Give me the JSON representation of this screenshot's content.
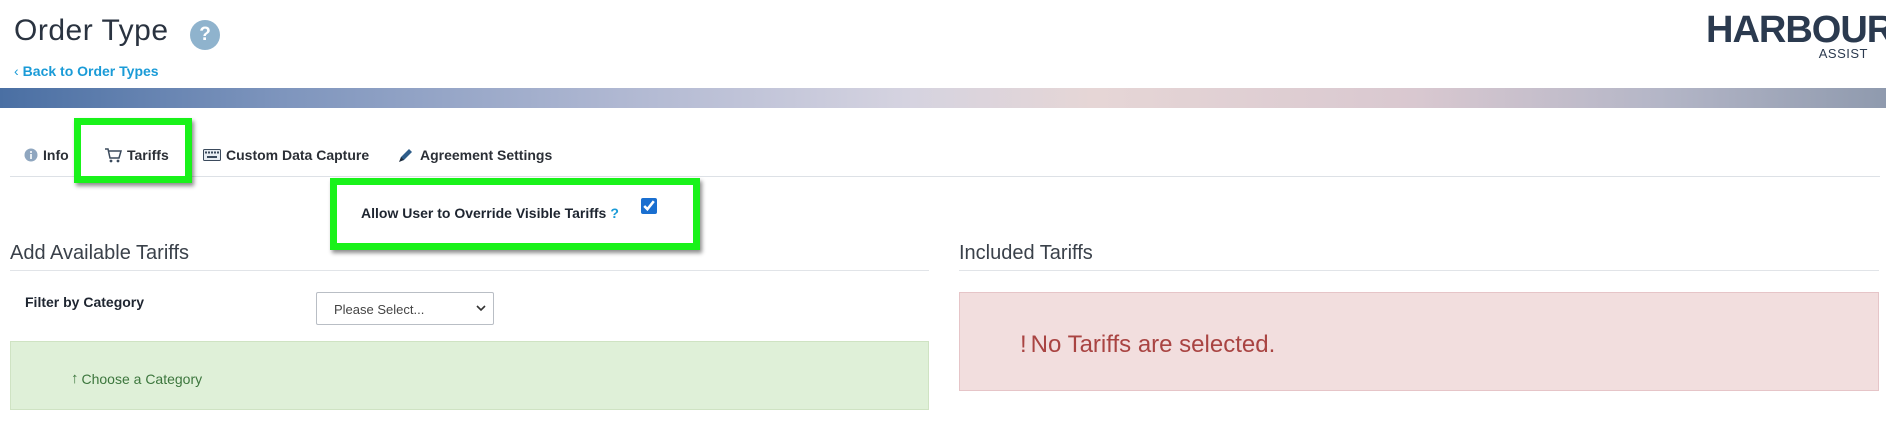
{
  "header": {
    "title": "Order Type",
    "help_symbol": "?",
    "back_link": "Back to Order Types"
  },
  "logo": {
    "main": "HARBOUR",
    "sub": "ASSIST"
  },
  "tabs": [
    {
      "label": "Info",
      "icon": "info-icon"
    },
    {
      "label": "Tariffs",
      "icon": "cart-icon"
    },
    {
      "label": "Custom Data Capture",
      "icon": "keyboard-icon"
    },
    {
      "label": "Agreement Settings",
      "icon": "pen-icon"
    }
  ],
  "override": {
    "label": "Allow User to Override Visible Tariffs",
    "help": "?",
    "checked": true
  },
  "available": {
    "title": "Add Available Tariffs",
    "filter_label": "Filter by Category",
    "filter_value": "Please Select...",
    "choose_message": "Choose a Category"
  },
  "included": {
    "title": "Included Tariffs",
    "empty_icon": "!",
    "empty_message": "No Tariffs are selected."
  },
  "colors": {
    "highlight": "#19f21a",
    "link": "#1a9bd7",
    "success_bg": "#dff0d8",
    "success_text": "#3c763d",
    "danger_bg": "#f2dede",
    "danger_text": "#a94442"
  }
}
